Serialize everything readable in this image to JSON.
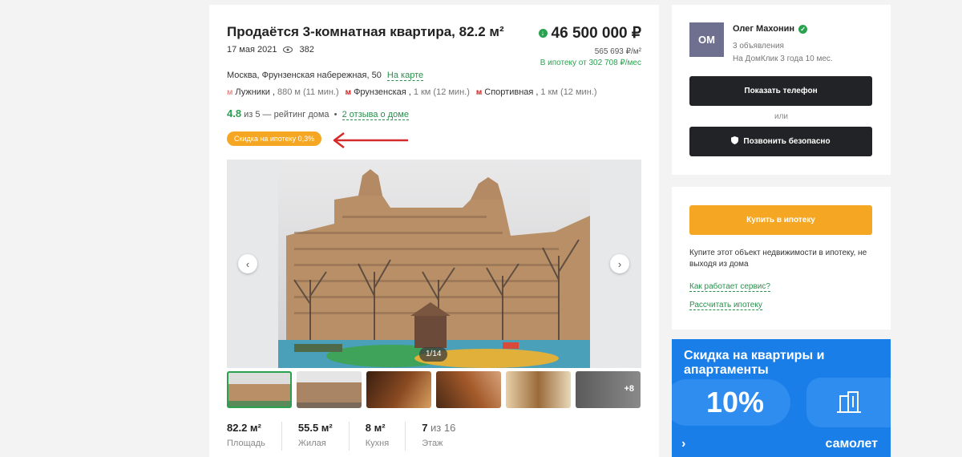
{
  "listing": {
    "title": "Продаётся 3-комнатная квартира, 82.2 м²",
    "date": "17 мая 2021",
    "views": "382",
    "price": "46 500 000 ₽",
    "price_per_m": "565 693 ₽/м²",
    "mortgage_from": "В ипотеку от 302 708 ₽/мес",
    "address": "Москва, Фрунзенская набережная, 50",
    "map_link": "На карте",
    "metro": [
      {
        "name": "Лужники",
        "distance": "880 м (11 мин.)"
      },
      {
        "name": "Фрунзенская",
        "distance": "1 км (12 мин.)"
      },
      {
        "name": "Спортивная",
        "distance": "1 км (12 мин.)"
      }
    ],
    "rating_value": "4.8",
    "rating_text": " из 5 — рейтинг дома",
    "reviews_link": "2 отзыва о доме",
    "badge": "Скидка на ипотеку 0,3%",
    "gallery_counter": "1/14",
    "more_photos": "+8",
    "specs": [
      {
        "value": "82.2 м²",
        "label": "Площадь"
      },
      {
        "value": "55.5 м²",
        "label": "Жилая"
      },
      {
        "value": "8 м²",
        "label": "Кухня"
      },
      {
        "value": "7",
        "value_suffix": " из 16",
        "label": "Этаж"
      }
    ]
  },
  "agent": {
    "initials": "ОМ",
    "name": "Олег Махонин",
    "listings": "3 объявления",
    "since": "На ДомКлик 3 года 10 мес.",
    "show_phone": "Показать телефон",
    "or": "или",
    "call_safe": "Позвонить безопасно"
  },
  "mortgage": {
    "button": "Купить в ипотеку",
    "text": "Купите этот объект недвижимости в ипотеку, не выходя из дома",
    "how_link": "Как работает сервис?",
    "calc_link": "Рассчитать ипотеку"
  },
  "promo": {
    "title": "Скидка на квартиры и апартаменты",
    "percent": "10%",
    "brand": "самолет"
  },
  "colors": {
    "accent_green": "#2aa14f",
    "orange": "#f5a623",
    "dark_button": "#222326",
    "promo_blue": "#1a7ee8"
  }
}
